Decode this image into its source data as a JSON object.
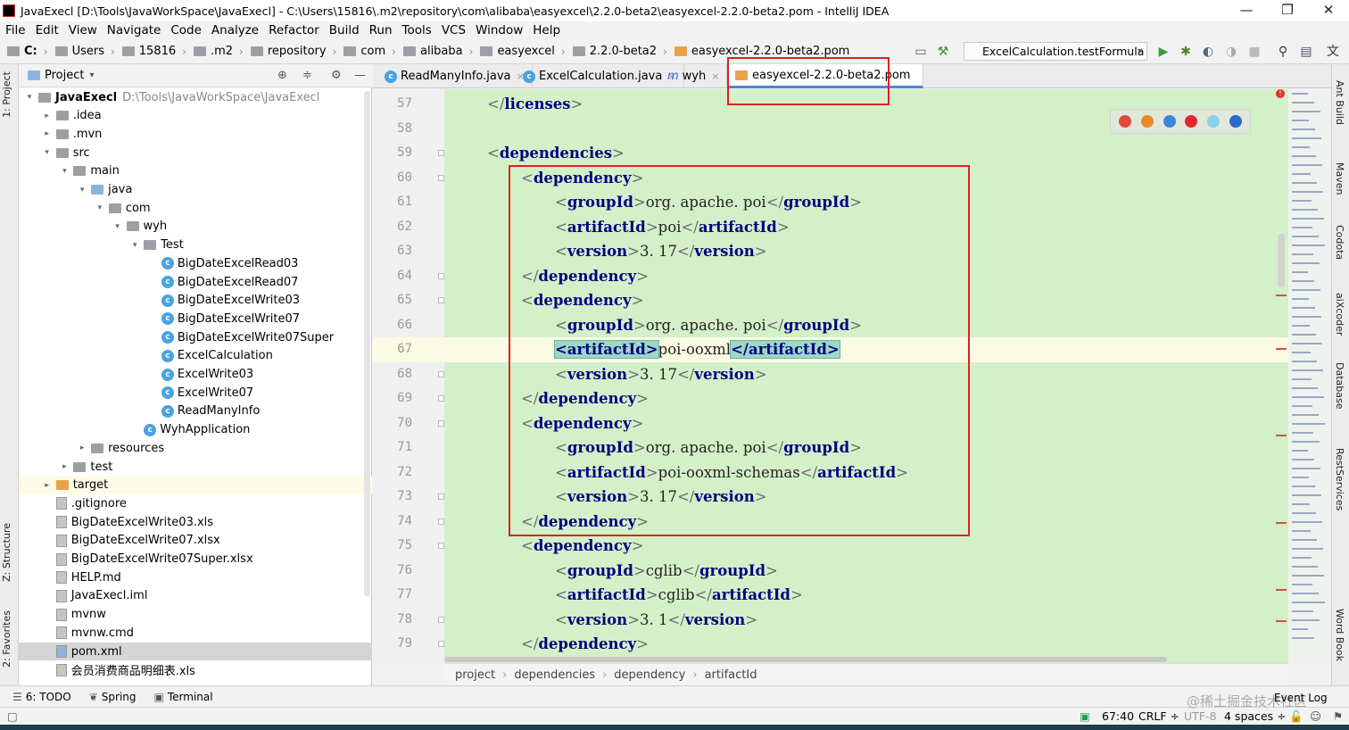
{
  "window": {
    "title": "JavaExecl [D:\\Tools\\JavaWorkSpace\\JavaExecl] - C:\\Users\\15816\\.m2\\repository\\com\\alibaba\\easyexcel\\2.2.0-beta2\\easyexcel-2.2.0-beta2.pom - IntelliJ IDEA",
    "minimize": "—",
    "maximize": "❐",
    "close": "✕"
  },
  "menu": [
    "File",
    "Edit",
    "View",
    "Navigate",
    "Code",
    "Analyze",
    "Refactor",
    "Build",
    "Run",
    "Tools",
    "VCS",
    "Window",
    "Help"
  ],
  "nav": {
    "crumbs": [
      "C:",
      "Users",
      "15816",
      ".m2",
      "repository",
      "com",
      "alibaba",
      "easyexcel",
      "2.2.0-beta2",
      "easyexcel-2.2.0-beta2.pom"
    ],
    "run_config": "ExcelCalculation.testFormula"
  },
  "left_strip": {
    "project": "1: Project",
    "structure": "Z: Structure",
    "favorites": "2: Favorites"
  },
  "project_panel": {
    "title": "Project",
    "tree": [
      {
        "label": "JavaExecl",
        "extra": "D:\\Tools\\JavaWorkSpace\\JavaExecl",
        "depth": 0,
        "arrow": "▾",
        "icon": "folder"
      },
      {
        "label": ".idea",
        "depth": 1,
        "arrow": "▸",
        "icon": "folder"
      },
      {
        "label": ".mvn",
        "depth": 1,
        "arrow": "▸",
        "icon": "folder"
      },
      {
        "label": "src",
        "depth": 1,
        "arrow": "▾",
        "icon": "folder"
      },
      {
        "label": "main",
        "depth": 2,
        "arrow": "▾",
        "icon": "folder"
      },
      {
        "label": "java",
        "depth": 3,
        "arrow": "▾",
        "icon": "folderblue"
      },
      {
        "label": "com",
        "depth": 4,
        "arrow": "▾",
        "icon": "folder"
      },
      {
        "label": "wyh",
        "depth": 5,
        "arrow": "▾",
        "icon": "folder"
      },
      {
        "label": "Test",
        "depth": 6,
        "arrow": "▾",
        "icon": "folder"
      },
      {
        "label": "BigDateExcelRead03",
        "depth": 7,
        "arrow": "",
        "icon": "class"
      },
      {
        "label": "BigDateExcelRead07",
        "depth": 7,
        "arrow": "",
        "icon": "class"
      },
      {
        "label": "BigDateExcelWrite03",
        "depth": 7,
        "arrow": "",
        "icon": "class"
      },
      {
        "label": "BigDateExcelWrite07",
        "depth": 7,
        "arrow": "",
        "icon": "class"
      },
      {
        "label": "BigDateExcelWrite07Super",
        "depth": 7,
        "arrow": "",
        "icon": "class"
      },
      {
        "label": "ExcelCalculation",
        "depth": 7,
        "arrow": "",
        "icon": "class"
      },
      {
        "label": "ExcelWrite03",
        "depth": 7,
        "arrow": "",
        "icon": "class"
      },
      {
        "label": "ExcelWrite07",
        "depth": 7,
        "arrow": "",
        "icon": "class"
      },
      {
        "label": "ReadManyInfo",
        "depth": 7,
        "arrow": "",
        "icon": "class"
      },
      {
        "label": "WyhApplication",
        "depth": 6,
        "arrow": "",
        "icon": "class"
      },
      {
        "label": "resources",
        "depth": 3,
        "arrow": "▸",
        "icon": "folder"
      },
      {
        "label": "test",
        "depth": 2,
        "arrow": "▸",
        "icon": "folder"
      },
      {
        "label": "target",
        "depth": 1,
        "arrow": "▸",
        "icon": "folderorange"
      },
      {
        "label": ".gitignore",
        "depth": 1,
        "arrow": "",
        "icon": "file"
      },
      {
        "label": "BigDateExcelWrite03.xls",
        "depth": 1,
        "arrow": "",
        "icon": "file"
      },
      {
        "label": "BigDateExcelWrite07.xlsx",
        "depth": 1,
        "arrow": "",
        "icon": "file"
      },
      {
        "label": "BigDateExcelWrite07Super.xlsx",
        "depth": 1,
        "arrow": "",
        "icon": "file"
      },
      {
        "label": "HELP.md",
        "depth": 1,
        "arrow": "",
        "icon": "file"
      },
      {
        "label": "JavaExecl.iml",
        "depth": 1,
        "arrow": "",
        "icon": "file"
      },
      {
        "label": "mvnw",
        "depth": 1,
        "arrow": "",
        "icon": "file"
      },
      {
        "label": "mvnw.cmd",
        "depth": 1,
        "arrow": "",
        "icon": "file"
      },
      {
        "label": "pom.xml",
        "depth": 1,
        "arrow": "",
        "icon": "maven"
      },
      {
        "label": "会员消费商品明细表.xls",
        "depth": 1,
        "arrow": "",
        "icon": "file"
      }
    ]
  },
  "tabs": [
    {
      "label": "ReadManyInfo.java",
      "close": "×"
    },
    {
      "label": "ExcelCalculation.java",
      "close": "×"
    },
    {
      "label": "wyh",
      "close": "×"
    },
    {
      "label": "easyexcel-2.2.0-beta2.pom",
      "close": ""
    }
  ],
  "code": {
    "lines": [
      {
        "n": "57",
        "indent": 1,
        "parts": [
          [
            "br",
            "</"
          ],
          [
            "b",
            "licenses"
          ],
          [
            "br",
            ">"
          ]
        ]
      },
      {
        "n": "58",
        "indent": 0,
        "parts": []
      },
      {
        "n": "59",
        "indent": 1,
        "parts": [
          [
            "br",
            "<"
          ],
          [
            "b",
            "dependencies"
          ],
          [
            "br",
            ">"
          ]
        ]
      },
      {
        "n": "60",
        "indent": 2,
        "parts": [
          [
            "br",
            "<"
          ],
          [
            "b",
            "dependency"
          ],
          [
            "br",
            ">"
          ]
        ]
      },
      {
        "n": "61",
        "indent": 3,
        "parts": [
          [
            "br",
            "<"
          ],
          [
            "b",
            "groupId"
          ],
          [
            "br",
            ">"
          ],
          [
            "txt",
            "org. apache. poi"
          ],
          [
            "br",
            "</"
          ],
          [
            "b",
            "groupId"
          ],
          [
            "br",
            ">"
          ]
        ]
      },
      {
        "n": "62",
        "indent": 3,
        "parts": [
          [
            "br",
            "<"
          ],
          [
            "b",
            "artifactId"
          ],
          [
            "br",
            ">"
          ],
          [
            "txt",
            "poi"
          ],
          [
            "br",
            "</"
          ],
          [
            "b",
            "artifactId"
          ],
          [
            "br",
            ">"
          ]
        ]
      },
      {
        "n": "63",
        "indent": 3,
        "parts": [
          [
            "br",
            "<"
          ],
          [
            "b",
            "version"
          ],
          [
            "br",
            ">"
          ],
          [
            "txt",
            "3. 17"
          ],
          [
            "br",
            "</"
          ],
          [
            "b",
            "version"
          ],
          [
            "br",
            ">"
          ]
        ]
      },
      {
        "n": "64",
        "indent": 2,
        "parts": [
          [
            "br",
            "</"
          ],
          [
            "b",
            "dependency"
          ],
          [
            "br",
            ">"
          ]
        ]
      },
      {
        "n": "65",
        "indent": 2,
        "parts": [
          [
            "br",
            "<"
          ],
          [
            "b",
            "dependency"
          ],
          [
            "br",
            ">"
          ]
        ]
      },
      {
        "n": "66",
        "indent": 3,
        "parts": [
          [
            "br",
            "<"
          ],
          [
            "b",
            "groupId"
          ],
          [
            "br",
            ">"
          ],
          [
            "txt",
            "org. apache. poi"
          ],
          [
            "br",
            "</"
          ],
          [
            "b",
            "groupId"
          ],
          [
            "br",
            ">"
          ]
        ]
      },
      {
        "n": "67",
        "indent": 3,
        "cur": true,
        "parts": [
          [
            "tb",
            "<artifactId>"
          ],
          [
            "txt",
            "poi-ooxml"
          ],
          [
            "tb",
            "</artifactId>"
          ]
        ]
      },
      {
        "n": "68",
        "indent": 3,
        "parts": [
          [
            "br",
            "<"
          ],
          [
            "b",
            "version"
          ],
          [
            "br",
            ">"
          ],
          [
            "txt",
            "3. 17"
          ],
          [
            "br",
            "</"
          ],
          [
            "b",
            "version"
          ],
          [
            "br",
            ">"
          ]
        ]
      },
      {
        "n": "69",
        "indent": 2,
        "parts": [
          [
            "br",
            "</"
          ],
          [
            "b",
            "dependency"
          ],
          [
            "br",
            ">"
          ]
        ]
      },
      {
        "n": "70",
        "indent": 2,
        "parts": [
          [
            "br",
            "<"
          ],
          [
            "b",
            "dependency"
          ],
          [
            "br",
            ">"
          ]
        ]
      },
      {
        "n": "71",
        "indent": 3,
        "parts": [
          [
            "br",
            "<"
          ],
          [
            "b",
            "groupId"
          ],
          [
            "br",
            ">"
          ],
          [
            "txt",
            "org. apache. poi"
          ],
          [
            "br",
            "</"
          ],
          [
            "b",
            "groupId"
          ],
          [
            "br",
            ">"
          ]
        ]
      },
      {
        "n": "72",
        "indent": 3,
        "parts": [
          [
            "br",
            "<"
          ],
          [
            "b",
            "artifactId"
          ],
          [
            "br",
            ">"
          ],
          [
            "txt",
            "poi-ooxml-schemas"
          ],
          [
            "br",
            "</"
          ],
          [
            "b",
            "artifactId"
          ],
          [
            "br",
            ">"
          ]
        ]
      },
      {
        "n": "73",
        "indent": 3,
        "parts": [
          [
            "br",
            "<"
          ],
          [
            "b",
            "version"
          ],
          [
            "br",
            ">"
          ],
          [
            "txt",
            "3. 17"
          ],
          [
            "br",
            "</"
          ],
          [
            "b",
            "version"
          ],
          [
            "br",
            ">"
          ]
        ]
      },
      {
        "n": "74",
        "indent": 2,
        "parts": [
          [
            "br",
            "</"
          ],
          [
            "b",
            "dependency"
          ],
          [
            "br",
            ">"
          ]
        ]
      },
      {
        "n": "75",
        "indent": 2,
        "parts": [
          [
            "br",
            "<"
          ],
          [
            "b",
            "dependency"
          ],
          [
            "br",
            ">"
          ]
        ]
      },
      {
        "n": "76",
        "indent": 3,
        "parts": [
          [
            "br",
            "<"
          ],
          [
            "b",
            "groupId"
          ],
          [
            "br",
            ">"
          ],
          [
            "txt",
            "cglib"
          ],
          [
            "br",
            "</"
          ],
          [
            "b",
            "groupId"
          ],
          [
            "br",
            ">"
          ]
        ]
      },
      {
        "n": "77",
        "indent": 3,
        "parts": [
          [
            "br",
            "<"
          ],
          [
            "b",
            "artifactId"
          ],
          [
            "br",
            ">"
          ],
          [
            "txt",
            "cglib"
          ],
          [
            "br",
            "</"
          ],
          [
            "b",
            "artifactId"
          ],
          [
            "br",
            ">"
          ]
        ]
      },
      {
        "n": "78",
        "indent": 3,
        "parts": [
          [
            "br",
            "<"
          ],
          [
            "b",
            "version"
          ],
          [
            "br",
            ">"
          ],
          [
            "txt",
            "3. 1"
          ],
          [
            "br",
            "</"
          ],
          [
            "b",
            "version"
          ],
          [
            "br",
            ">"
          ]
        ]
      },
      {
        "n": "79",
        "indent": 2,
        "parts": [
          [
            "br",
            "</"
          ],
          [
            "b",
            "dependency"
          ],
          [
            "br",
            ">"
          ]
        ]
      }
    ]
  },
  "editor_breadcrumb": [
    "project",
    "dependencies",
    "dependency",
    "artifactId"
  ],
  "right_strip": [
    "Ant Build",
    "Maven",
    "Codota",
    "aiXcoder",
    "Database",
    "RestServices",
    "Word Book"
  ],
  "bottom_tabs": [
    "6: TODO",
    "Spring",
    "Terminal"
  ],
  "status": {
    "event_log": "Event Log",
    "position": "67:40",
    "line_sep": "CRLF ÷",
    "encoding": "UTF-8",
    "indent": "4 spaces ÷",
    "watermark": "@稀土掘金技术社区"
  },
  "colors": {
    "editor_bg": "#d4f0c8",
    "highlight": "#e02020",
    "accent": "#4a88d8"
  }
}
